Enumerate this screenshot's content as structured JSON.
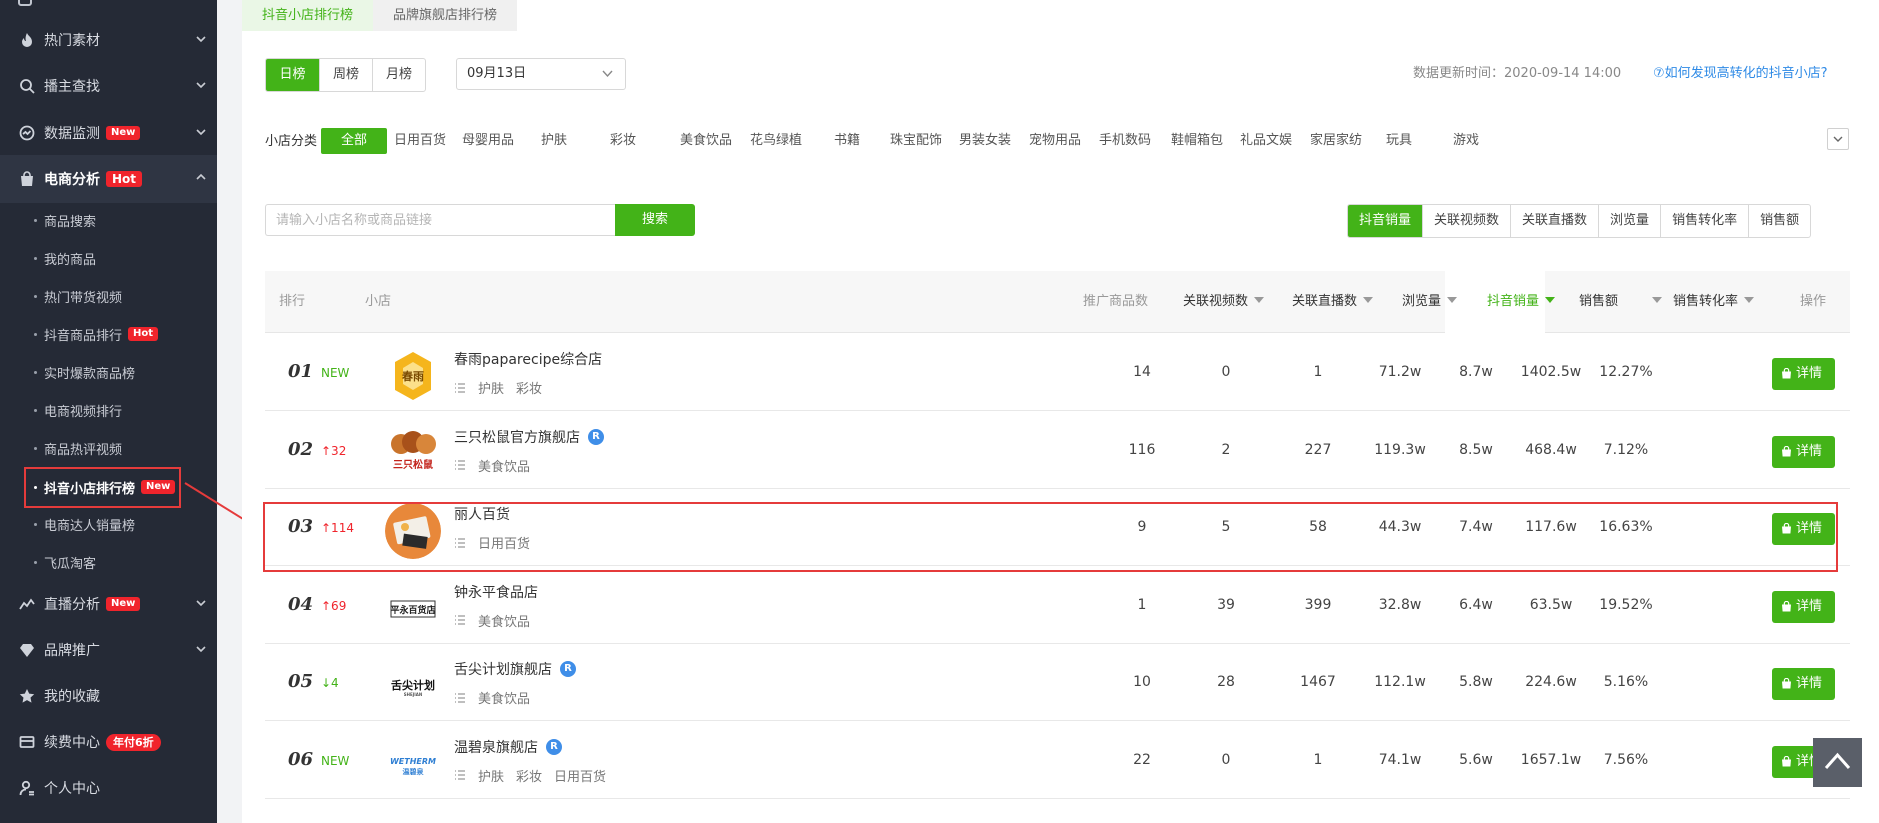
{
  "sidebar": {
    "menu": [
      {
        "label": "热门素材",
        "icon": "fire-icon"
      },
      {
        "label": "播主查找",
        "icon": "search-icon"
      },
      {
        "label": "数据监测",
        "icon": "monitor-icon",
        "badge": "New"
      },
      {
        "label": "电商分析",
        "icon": "shopping-bag-icon",
        "badge": "Hot"
      }
    ],
    "submenu": [
      {
        "label": "商品搜索"
      },
      {
        "label": "我的商品"
      },
      {
        "label": "热门带货视频"
      },
      {
        "label": "抖音商品排行",
        "badge": "Hot"
      },
      {
        "label": "实时爆款商品榜"
      },
      {
        "label": "电商视频排行"
      },
      {
        "label": "商品热评视频"
      },
      {
        "label": "抖音小店排行榜",
        "badge": "New"
      },
      {
        "label": "电商达人销量榜"
      },
      {
        "label": "飞瓜淘客"
      }
    ],
    "bottom": [
      {
        "label": "直播分析",
        "icon": "live-analytics-icon",
        "badge": "New"
      },
      {
        "label": "品牌推广",
        "icon": "diamond-icon"
      },
      {
        "label": "我的收藏",
        "icon": "star-icon"
      },
      {
        "label": "续费中心",
        "icon": "card-icon",
        "badge": "年付6折"
      },
      {
        "label": "个人中心",
        "icon": "user-icon"
      }
    ]
  },
  "top_tabs": [
    "抖音小店排行榜",
    "品牌旗舰店排行榜"
  ],
  "period_tabs": [
    "日榜",
    "周榜",
    "月榜"
  ],
  "date_select": "09月13日",
  "update_time": "数据更新时间：2020-09-14 14:00",
  "help_link": "⑦如何发现高转化的抖音小店?",
  "category": {
    "label": "小店分类",
    "items": [
      "全部",
      "日用百货",
      "母婴用品",
      "护肤",
      "彩妆",
      "美食饮品",
      "花鸟绿植",
      "书籍",
      "珠宝配饰",
      "男装女装",
      "宠物用品",
      "手机数码",
      "鞋帽箱包",
      "礼品文娱",
      "家居家纺",
      "玩具",
      "游戏"
    ]
  },
  "search": {
    "placeholder": "请输入小店名称或商品链接",
    "button": "搜索"
  },
  "sort_buttons": [
    "抖音销量",
    "关联视频数",
    "关联直播数",
    "浏览量",
    "销售转化率",
    "销售额"
  ],
  "table": {
    "headers": {
      "rank": "排行",
      "shop": "小店",
      "products": "推广商品数",
      "videos": "关联视频数",
      "lives": "关联直播数",
      "views": "浏览量",
      "sales": "抖音销量",
      "revenue": "销售额",
      "conversion": "销售转化率",
      "action": "操作"
    },
    "detail_label": "详情",
    "rows": [
      {
        "rank": "01",
        "change": "NEW",
        "change_type": "new",
        "name": "春雨paparecipe综合店",
        "verified": false,
        "tags": [
          "护肤",
          "彩妆"
        ],
        "logo": "春雨",
        "products": "14",
        "videos": "0",
        "lives": "1",
        "views": "71.2w",
        "sales": "8.7w",
        "revenue": "1402.5w",
        "conversion": "12.27%"
      },
      {
        "rank": "02",
        "change": "↑32",
        "change_type": "up",
        "name": "三只松鼠官方旗舰店",
        "verified": true,
        "tags": [
          "美食饮品"
        ],
        "logo": "三只松鼠",
        "products": "116",
        "videos": "2",
        "lives": "227",
        "views": "119.3w",
        "sales": "8.5w",
        "revenue": "468.4w",
        "conversion": "7.12%"
      },
      {
        "rank": "03",
        "change": "↑114",
        "change_type": "up",
        "name": "丽人百货",
        "verified": false,
        "tags": [
          "日用百货"
        ],
        "logo": "",
        "products": "9",
        "videos": "5",
        "lives": "58",
        "views": "44.3w",
        "sales": "7.4w",
        "revenue": "117.6w",
        "conversion": "16.63%"
      },
      {
        "rank": "04",
        "change": "↑69",
        "change_type": "up",
        "name": "钟永平食品店",
        "verified": false,
        "tags": [
          "美食饮品"
        ],
        "logo": "平永百货店",
        "products": "1",
        "videos": "39",
        "lives": "399",
        "views": "32.8w",
        "sales": "6.4w",
        "revenue": "63.5w",
        "conversion": "19.52%"
      },
      {
        "rank": "05",
        "change": "↓4",
        "change_type": "down",
        "name": "舌尖计划旗舰店",
        "verified": true,
        "tags": [
          "美食饮品"
        ],
        "logo": "舌尖计划",
        "products": "10",
        "videos": "28",
        "lives": "1467",
        "views": "112.1w",
        "sales": "5.8w",
        "revenue": "224.6w",
        "conversion": "5.16%"
      },
      {
        "rank": "06",
        "change": "NEW",
        "change_type": "new",
        "name": "温碧泉旗舰店",
        "verified": true,
        "tags": [
          "护肤",
          "彩妆",
          "日用百货"
        ],
        "logo": "WETHERM",
        "products": "22",
        "videos": "0",
        "lives": "1",
        "views": "74.1w",
        "sales": "5.6w",
        "revenue": "1657.1w",
        "conversion": "7.56%"
      }
    ]
  },
  "verified_mark": "R",
  "colors": {
    "accent": "#43b318",
    "sidebar_bg": "#252a36",
    "badge_red": "#f0242c",
    "highlight_red": "#e53b3b",
    "link_blue": "#2e8ae6"
  }
}
